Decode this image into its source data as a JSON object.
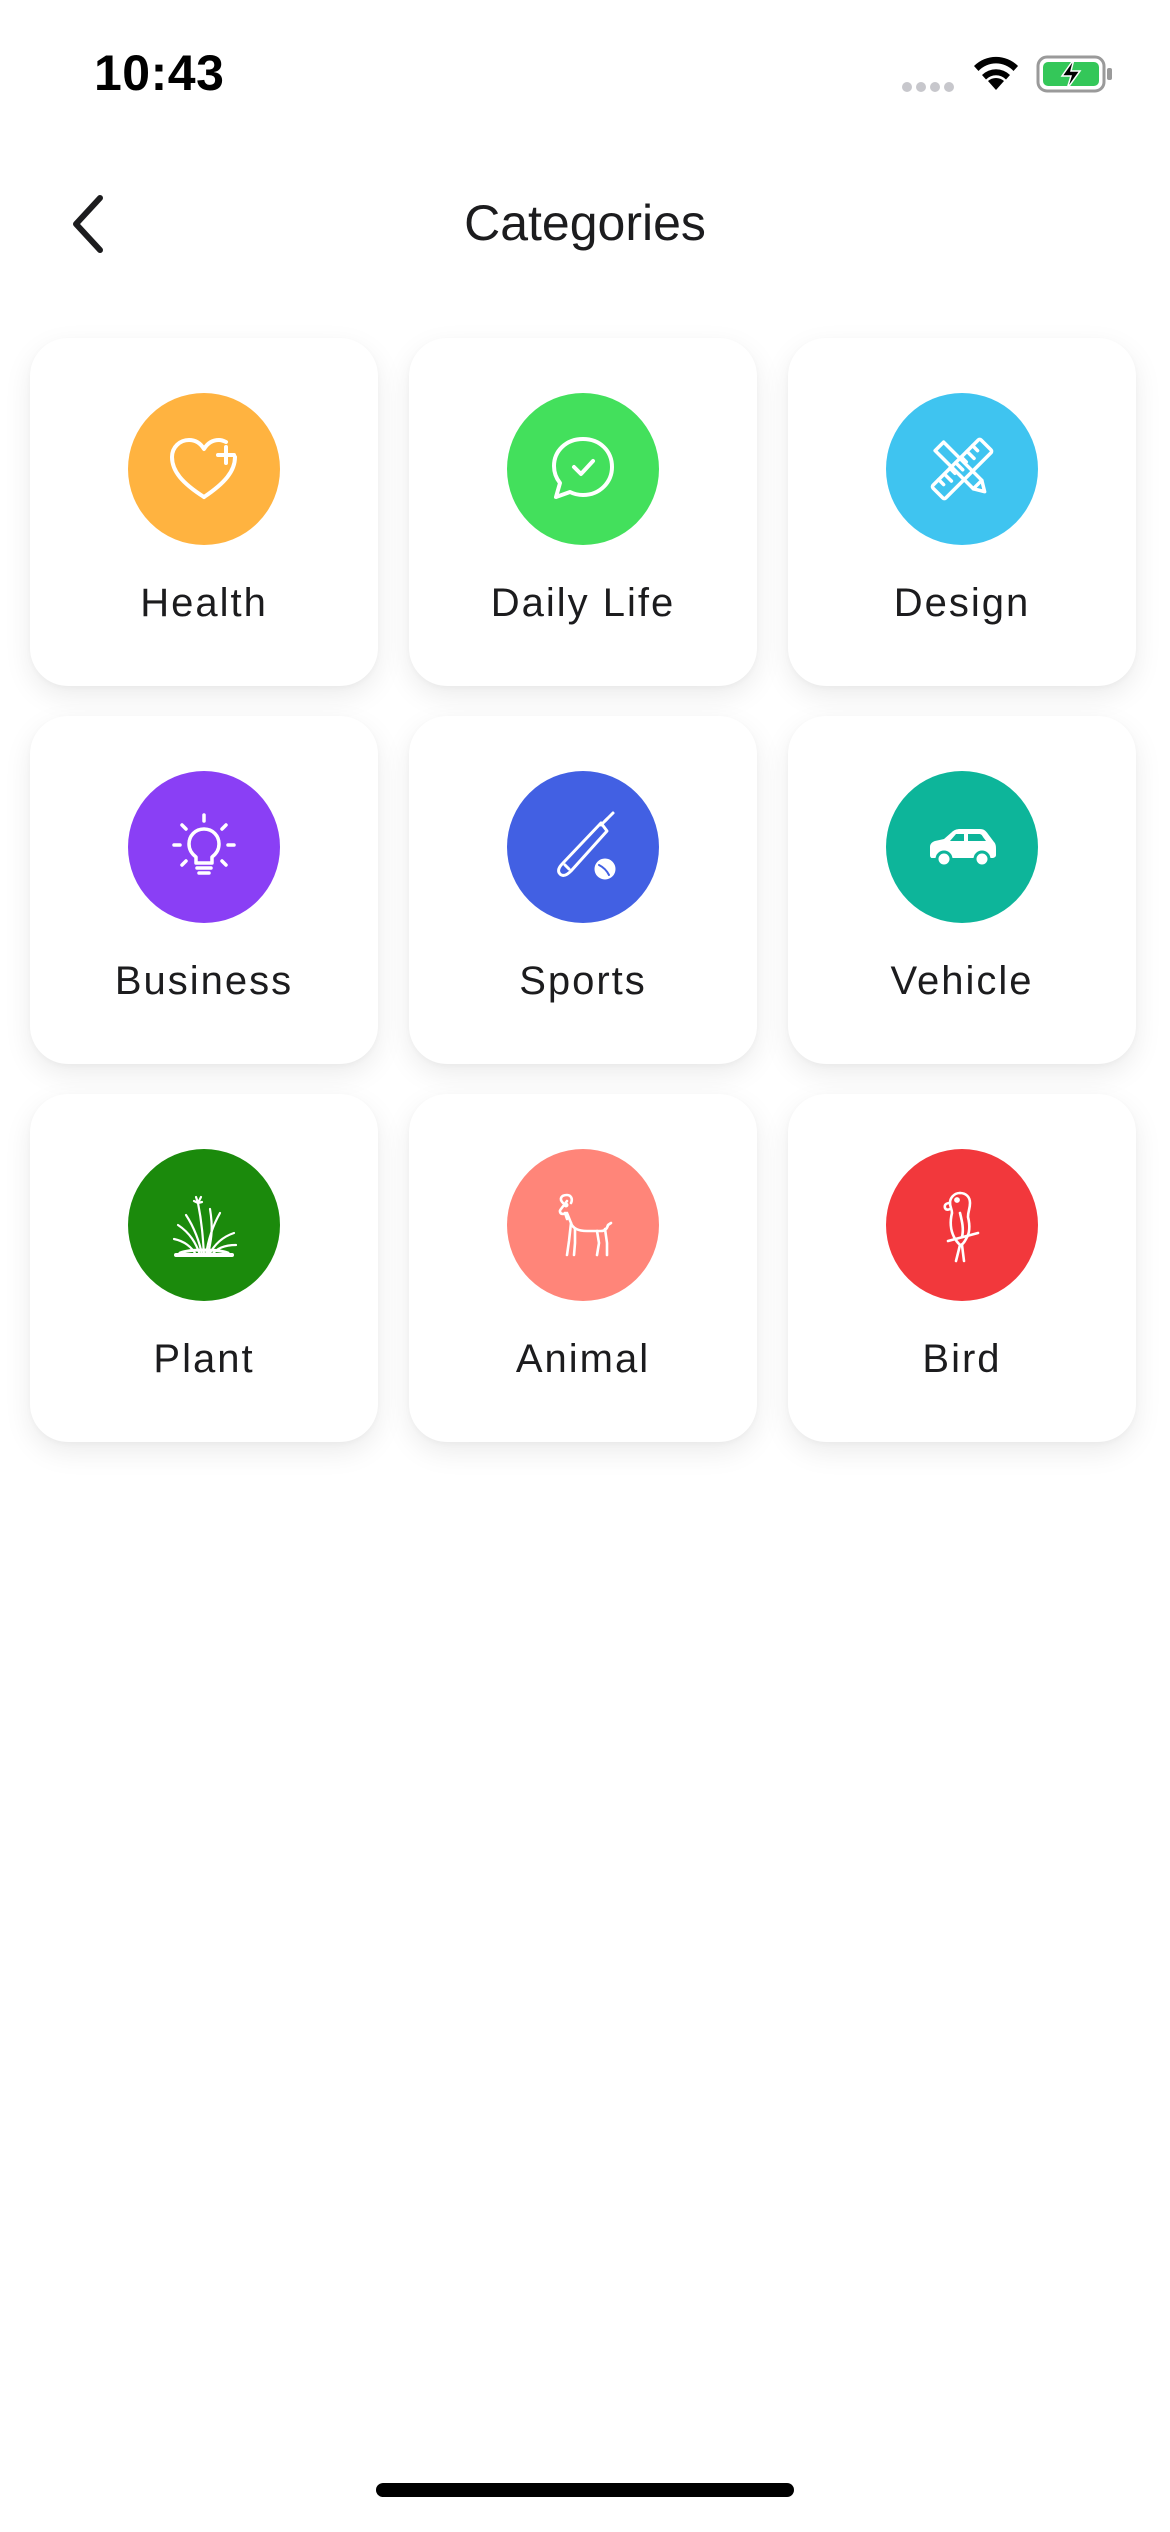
{
  "status_bar": {
    "time": "10:43"
  },
  "nav": {
    "title": "Categories",
    "back_icon": "chevron-left-icon"
  },
  "categories": [
    {
      "label": "Health",
      "icon": "heart-plus-icon",
      "color": "#FFB340"
    },
    {
      "label": "Daily Life",
      "icon": "chat-check-icon",
      "color": "#43E05C"
    },
    {
      "label": "Design",
      "icon": "ruler-pencil-icon",
      "color": "#3FC4F0"
    },
    {
      "label": "Business",
      "icon": "lightbulb-icon",
      "color": "#8A3FF5"
    },
    {
      "label": "Sports",
      "icon": "cricket-bat-icon",
      "color": "#4260E3"
    },
    {
      "label": "Vehicle",
      "icon": "car-icon",
      "color": "#0DB59A"
    },
    {
      "label": "Plant",
      "icon": "grass-icon",
      "color": "#1B8A0C"
    },
    {
      "label": "Animal",
      "icon": "goat-icon",
      "color": "#FF8579"
    },
    {
      "label": "Bird",
      "icon": "parrot-icon",
      "color": "#F2383C"
    }
  ]
}
